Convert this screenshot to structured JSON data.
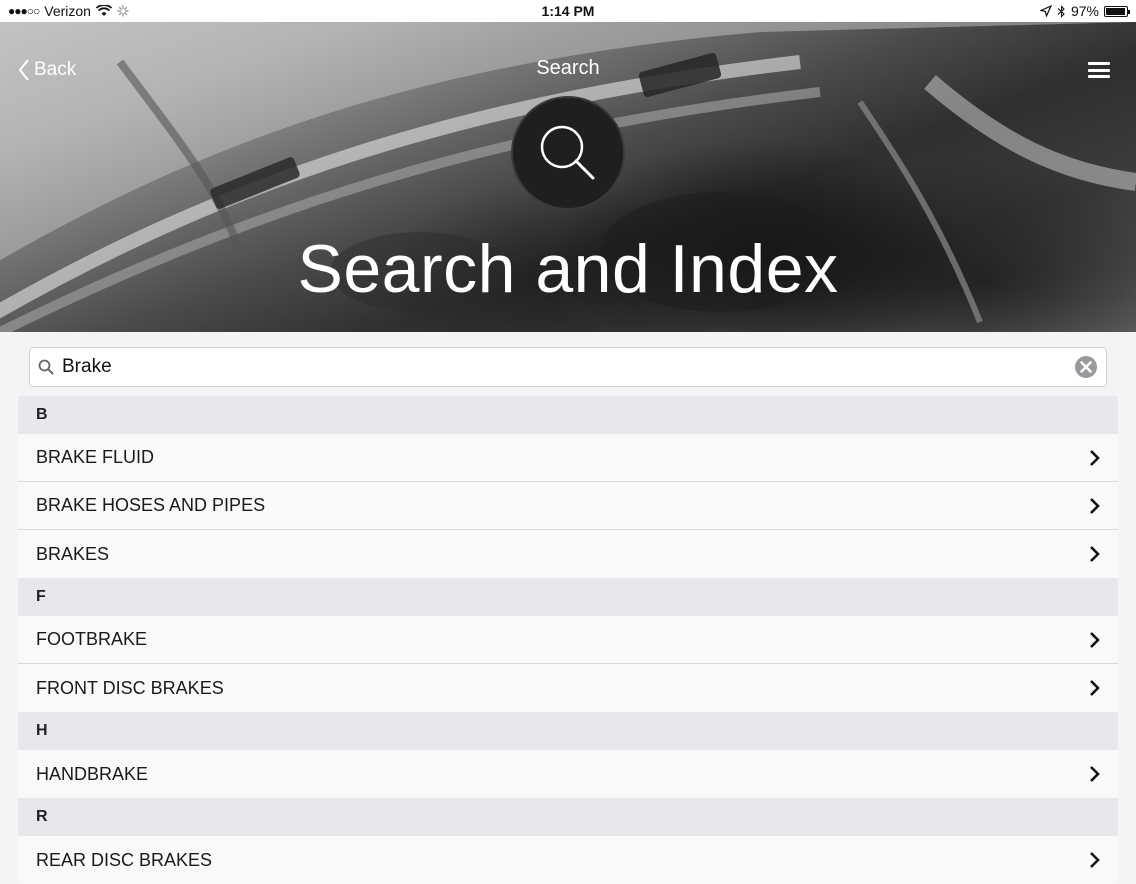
{
  "status_bar": {
    "signal": "●●●○○",
    "carrier": "Verizon",
    "time": "1:14 PM",
    "battery": "97%",
    "battery_level": 0.97
  },
  "nav": {
    "back_label": "Back",
    "title": "Search"
  },
  "hero": {
    "title": "Search and Index"
  },
  "search": {
    "value": "Brake",
    "placeholder": ""
  },
  "sections": [
    {
      "letter": "B",
      "items": [
        "BRAKE FLUID",
        "BRAKE HOSES AND PIPES",
        "BRAKES"
      ]
    },
    {
      "letter": "F",
      "items": [
        "FOOTBRAKE",
        "FRONT DISC BRAKES"
      ]
    },
    {
      "letter": "H",
      "items": [
        "HANDBRAKE"
      ]
    },
    {
      "letter": "R",
      "items": [
        "REAR DISC BRAKES"
      ]
    }
  ],
  "icons": {
    "search": "magnifier-icon",
    "clear": "clear-circle-icon",
    "chevron": "chevron-right-icon",
    "menu": "hamburger-menu-icon"
  },
  "colors": {
    "section_bg": "#e8e7eb",
    "row_bg": "#f9f9fa",
    "badge_bg": "#1f1f1f"
  }
}
